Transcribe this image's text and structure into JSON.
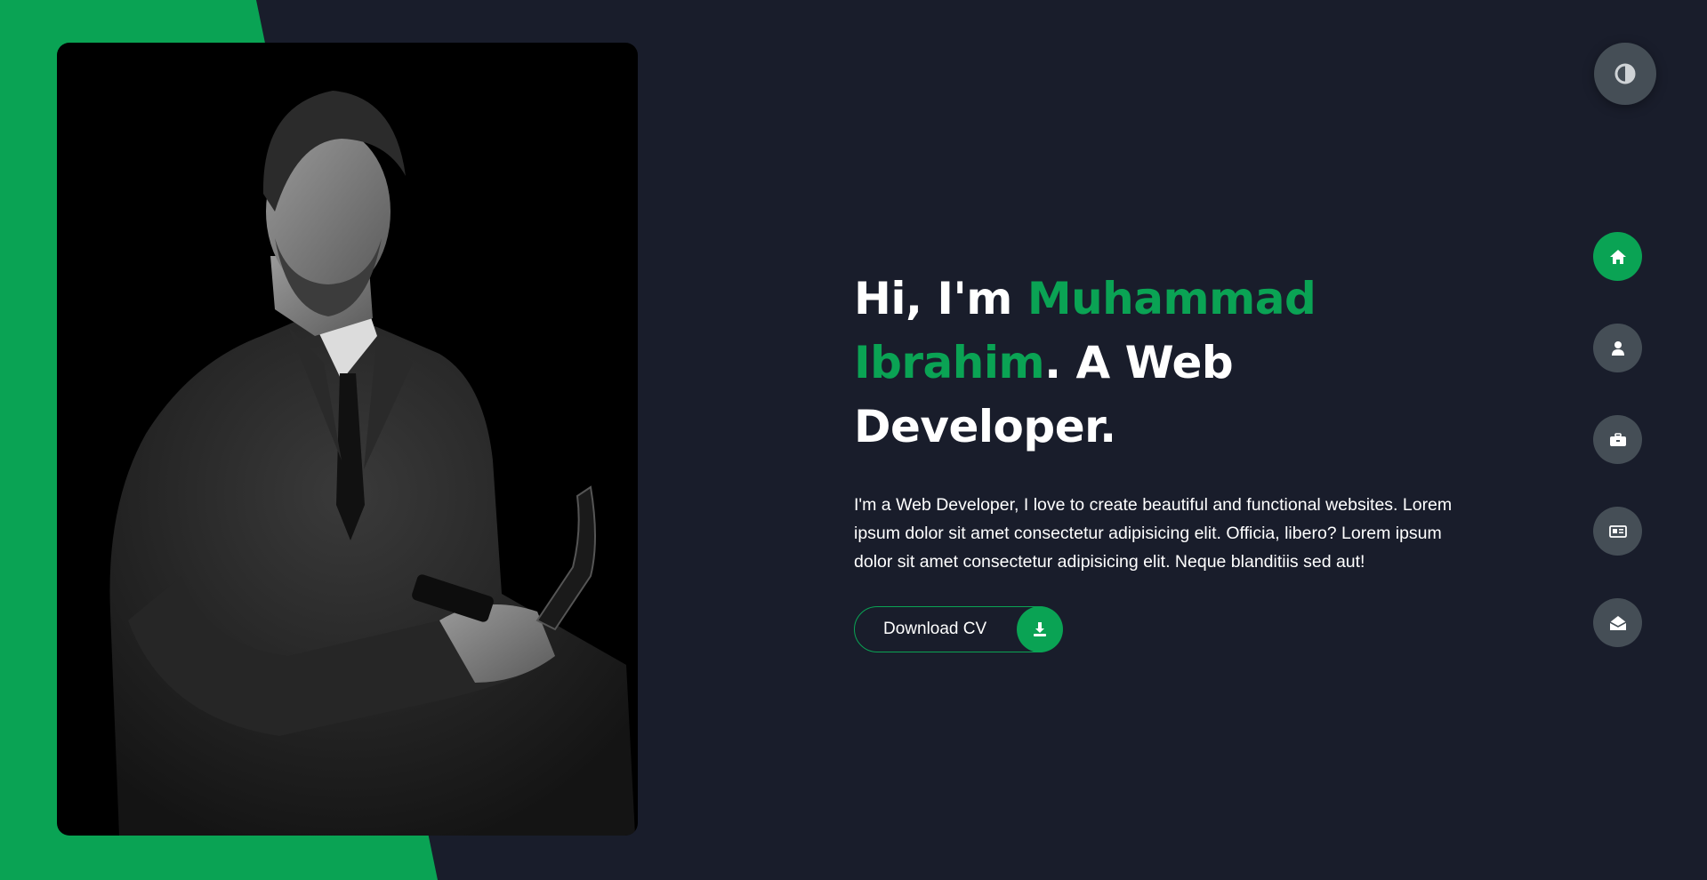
{
  "colors": {
    "accent": "#0aa354",
    "background": "#191d2b",
    "nav_inactive": "#454e56",
    "text": "#ffffff"
  },
  "hero": {
    "greeting": "Hi, I'm ",
    "name_first": "Muhammad",
    "name_last": "Ibrahim",
    "title_suffix": ". A Web Developer.",
    "description": "I'm a Web Developer, I love to create beautiful and functional websites. Lorem ipsum dolor sit amet consectetur adipisicing elit. Officia, libero? Lorem ipsum dolor sit amet consectetur adipisicing elit. Neque blanditiis sed aut!",
    "cv_button_label": "Download CV",
    "cv_button_icon": "download-icon"
  },
  "theme_toggle": {
    "icon": "contrast-icon"
  },
  "nav": {
    "items": [
      {
        "id": "home",
        "icon": "home-icon",
        "active": true
      },
      {
        "id": "about",
        "icon": "user-icon",
        "active": false
      },
      {
        "id": "portfolio",
        "icon": "briefcase-icon",
        "active": false
      },
      {
        "id": "blogs",
        "icon": "newspaper-icon",
        "active": false
      },
      {
        "id": "contact",
        "icon": "envelope-open-icon",
        "active": false
      }
    ]
  }
}
